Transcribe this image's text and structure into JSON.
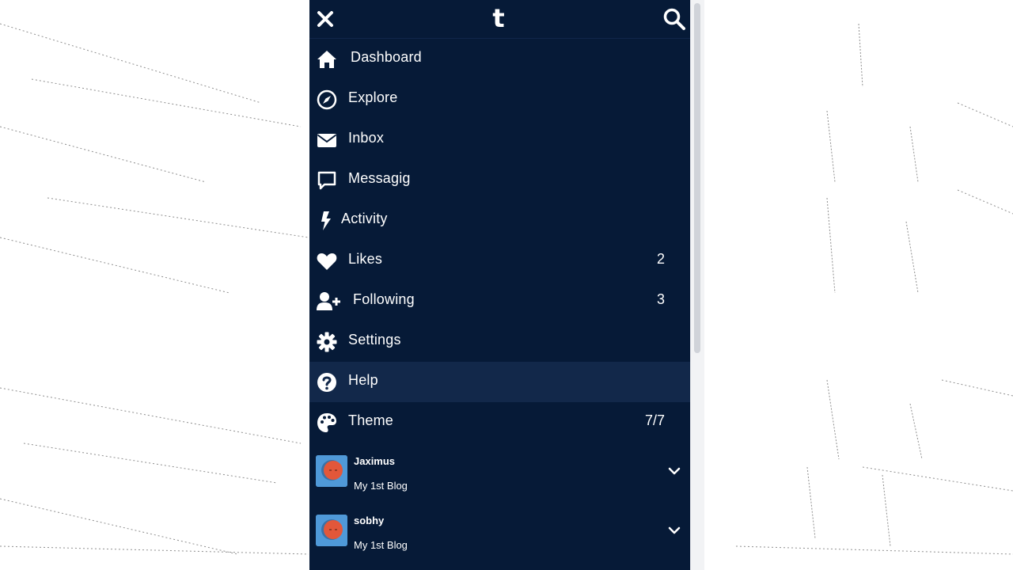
{
  "header": {
    "logo_text": "t",
    "close_icon": "close-icon",
    "search_icon": "search-icon"
  },
  "menu": [
    {
      "label": "Dashboard",
      "icon": "home-icon"
    },
    {
      "label": "Explore",
      "icon": "compass-icon"
    },
    {
      "label": "Inbox",
      "icon": "envelope-icon"
    },
    {
      "label": "Messagig",
      "icon": "chat-bubble-icon"
    },
    {
      "label": "Activity",
      "icon": "lightning-icon"
    },
    {
      "label": "Likes",
      "icon": "heart-icon",
      "count": "2"
    },
    {
      "label": "Following",
      "icon": "user-plus-icon",
      "count": "3"
    },
    {
      "label": "Settings",
      "icon": "gear-icon"
    },
    {
      "label": "Help",
      "icon": "question-circle-icon",
      "active": true
    },
    {
      "label": "Theme",
      "icon": "palette-icon",
      "count": "7/7"
    }
  ],
  "blogs": [
    {
      "name": "Jaximus",
      "title": "My 1st Blog"
    },
    {
      "name": "sobhy",
      "title": "My 1st Blog"
    }
  ],
  "colors": {
    "panel": "#061a37",
    "active_row": "#12284a",
    "avatar_bg": "#4f99d8",
    "avatar_face": "#e2573a"
  }
}
